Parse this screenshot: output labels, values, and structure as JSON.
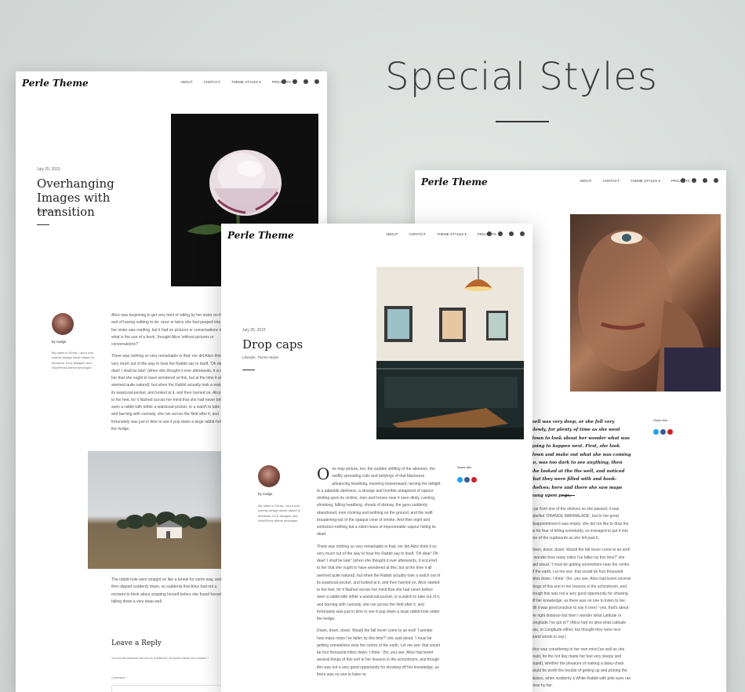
{
  "headline": "Special Styles",
  "site": {
    "logo": "Perle Theme",
    "menu": [
      "ABOUT",
      "CONTACT",
      "THEME STYLES",
      "PROJECTS"
    ],
    "menu_caret": "▾"
  },
  "page1": {
    "date": "July 25, 2015",
    "title": "Overhanging Images with transition",
    "category": "Theme Styles",
    "author": "by nudge",
    "bio": "My name is Sonia, I am a one woman design studio based in Montreal. I'm a designer and WordPress theme developer.",
    "body": [
      "Alice was beginning to get very tired of sitting by her sister on the bank, and of having nothing to do: once or twice she had peeped into the book her sister was reading, but it had no pictures or conversations in it, 'and what is the use of a book,' thought Alice 'without pictures or conversations?'",
      "There was nothing so very remarkable in that; nor did Alice think it so very much out of the way to hear the Rabbit say to itself, 'Oh dear! Oh dear! I shall be late!' (when she thought it over afterwards, it occurred to her that she ought to have wondered at this, but at the time it all seemed quite natural); but when the Rabbit actually took a watch out of its waistcoat-pocket, and looked at it, and then hurried on, Alice started to her feet, for it flashed across her mind that she had never before seen a rabbit with either a waistcoat-pocket, or a watch to take out of it, and burning with curiosity, she ran across the field after it, and fortunately was just in time to see it pop down a large rabbit-hole under the hedge."
    ],
    "after_image": "The rabbit-hole went straight on like a tunnel for some way, and then dipped suddenly down, so suddenly that Alice had not a moment to think about stopping herself before she found herself falling down a very deep well.",
    "reply_title": "Leave a Reply",
    "reply_note": "Your email address will not be published. Required fields are marked *",
    "comment_label": "Comment"
  },
  "page2": {
    "date": "July 25, 2015",
    "title": "Drop caps",
    "categories": "Lifestyle, Theme Styles",
    "author": "by nudge",
    "bio": "My name is Sonia, I am a one woman design studio based in Montreal. I'm a designer and WordPress theme developer.",
    "share_label": "Share this",
    "dropcap": "O",
    "body": [
      "ne may picture, too, the sudden shifting of the attention, the swiftly spreading coils and bellyings of that blackness advancing headlong, towering heavenward, turning the twilight to a palpable darkness, a strange and horrible antagonist of vapour striding upon its victims, men and horses near it seen dimly, running, shrieking, falling headlong, shouts of dismay, the guns suddenly abandoned, men choking and writhing on the ground, and the swift broadening-out of the opaque cone of smoke. And then night and extinction-nothing but a silent mass of impenetrable vapour hiding its dead.",
      "There was nothing so very remarkable in that; nor did Alice think it so very much out of the way to hear the Rabbit say to itself, 'Oh dear! Oh dear! I shall be late!' (when she thought it over afterwards, it occurred to her that she ought to have wondered at this, but at the time it all seemed quite natural); but when the Rabbit actually took a watch out of its waistcoat-pocket, and looked at it, and then hurried on, Alice started to her feet, for it flashed across her mind that she had never before seen a rabbit with either a waistcoat-pocket, or a watch to take out of it, and burning with curiosity, she ran across the field after it, and fortunately was just in time to see it pop down a large rabbit-hole under the hedge.",
      "Down, down, down. Would the fall never come to an end! 'I wonder how many miles I've fallen by this time?' she said aloud. 'I must be getting somewhere near the centre of the earth. Let me see: that would be four thousand miles down, I think-' (for, you see, Alice had learnt several things of this sort in her lessons in the schoolroom, and though this was not a very good opportunity for showing off her knowledge, as there was no one to listen to"
    ]
  },
  "page3": {
    "share_label": "Share this",
    "quote": "well was very deep, or she fell very slowly, for plenty of time as she went down to look about her wonder what was going to happen next. First, she look down and make out what she was coming to, was too dark to see anything; then she looked at the the well, and noticed that they were filled with and book-shelves; here and there she saw maps hung upon pegs.",
    "body": [
      "a jar from one of the shelves as she passed; it was labelled 'ORANGE MARMALADE', but to her great disappointment it was empty: she did not like to drop the jar for fear of killing somebody, so managed to put it into one of the cupboards as she fell past it.",
      "Down, down, down. Would the fall never come to an end! 'I wonder how many miles I've fallen by this time?' she said aloud. 'I must be getting somewhere near the centre of the earth. Let me see: that would be four thousand miles down, I think-' (for, you see, Alice had learnt several things of this sort in her lessons in the schoolroom, and though this was not a very good opportunity for showing off her knowledge, as there was no one to listen to her, still it was good practice to say it over) '-yes, that's about the right distance-but then I wonder what Latitude or Longitude I've got to?' (Alice had no idea what Latitude was, or Longitude either, but thought they were nice grand words to say.)",
      "Alice was considering in her own mind (as well as she could, for the hot day made her feel very sleepy and stupid), whether the pleasure of making a daisy-chain would be worth the trouble of getting up and picking the daisies, when suddenly a White Rabbit with pink eyes ran close by her."
    ]
  },
  "colors": {
    "twitter": "#1da1f2",
    "facebook": "#3b5998",
    "pinterest": "#cb2027"
  }
}
